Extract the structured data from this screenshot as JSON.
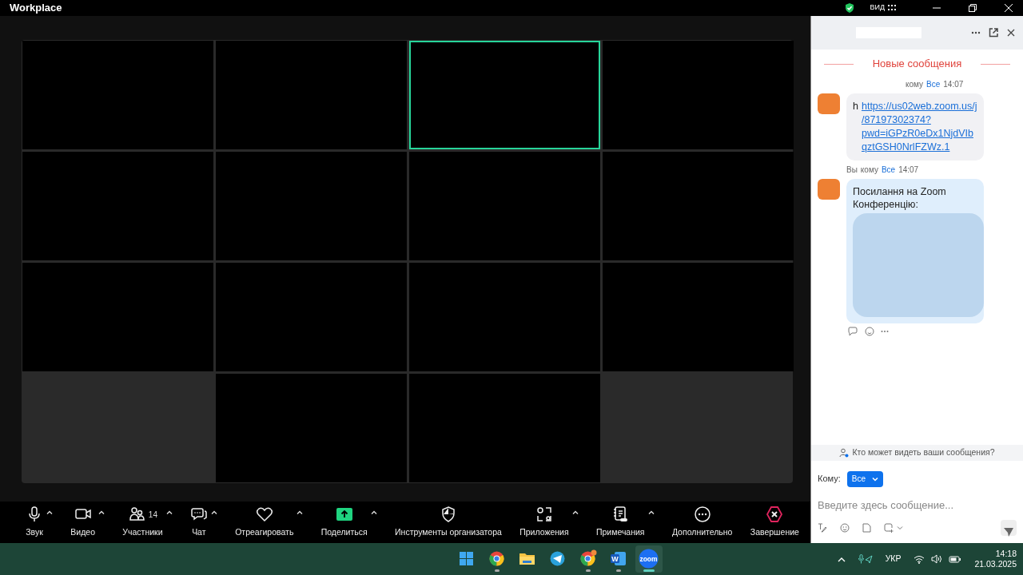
{
  "window": {
    "title": "Workplace",
    "view_label": "ВИД"
  },
  "video_tiles": [
    {
      "active_speaker": false
    },
    {
      "active_speaker": false
    },
    {
      "active_speaker": true
    },
    {
      "active_speaker": false
    },
    {
      "active_speaker": false
    },
    {
      "active_speaker": false
    },
    {
      "active_speaker": false
    },
    {
      "active_speaker": false
    },
    {
      "active_speaker": false
    },
    {
      "active_speaker": false
    },
    {
      "active_speaker": false
    },
    {
      "active_speaker": false
    },
    {
      "active_speaker": false
    },
    {
      "active_speaker": false
    }
  ],
  "chat": {
    "divider": "Новые сообщения",
    "messages": [
      {
        "kind": "received",
        "to_label": "кому",
        "recipient": "Все",
        "time": "14:07",
        "text": "h",
        "link": "https://us02web.zoom.us/j/87197302374?pwd=iGPzR0eDx1NjdVIbqztGSH0NrlFZWz.1"
      },
      {
        "kind": "sent",
        "sender": "Вы",
        "to_label": "кому",
        "recipient": "Все",
        "time": "14:07",
        "text": "Посилання на Zoom Конференцію:"
      }
    ],
    "privacy_notice": "Кто может видеть ваши сообщения?",
    "to_label": "Кому:",
    "recipient_button": "Все",
    "placeholder": "Введите здесь сообщение..."
  },
  "toolbar": [
    {
      "label": "Звук",
      "kind": "normal",
      "has_menu": true
    },
    {
      "label": "Видео",
      "kind": "normal",
      "has_menu": true
    },
    {
      "label": "Участники",
      "kind": "normal",
      "has_menu": true,
      "count": "14"
    },
    {
      "label": "Чат",
      "kind": "normal",
      "has_menu": true
    },
    {
      "label": "Отреагировать",
      "kind": "normal",
      "has_menu": true
    },
    {
      "label": "Поделиться",
      "kind": "share",
      "has_menu": true
    },
    {
      "label": "Инструменты организатора",
      "kind": "normal",
      "has_menu": false
    },
    {
      "label": "Приложения",
      "kind": "normal",
      "has_menu": true
    },
    {
      "label": "Примечания",
      "kind": "normal",
      "has_menu": true
    },
    {
      "label": "Дополнительно",
      "kind": "normal",
      "has_menu": false
    },
    {
      "label": "Завершение",
      "kind": "end",
      "has_menu": false
    }
  ],
  "taskbar": {
    "apps": [
      {
        "running": false,
        "active": false
      },
      {
        "running": true,
        "active": false
      },
      {
        "running": false,
        "active": false
      },
      {
        "running": false,
        "active": false
      },
      {
        "running": true,
        "active": false
      },
      {
        "running": true,
        "active": false,
        "label": "W"
      },
      {
        "running": true,
        "active": true,
        "label": "zoom"
      }
    ],
    "language": "УКР",
    "time": "14:18",
    "date": "21.03.2025"
  }
}
